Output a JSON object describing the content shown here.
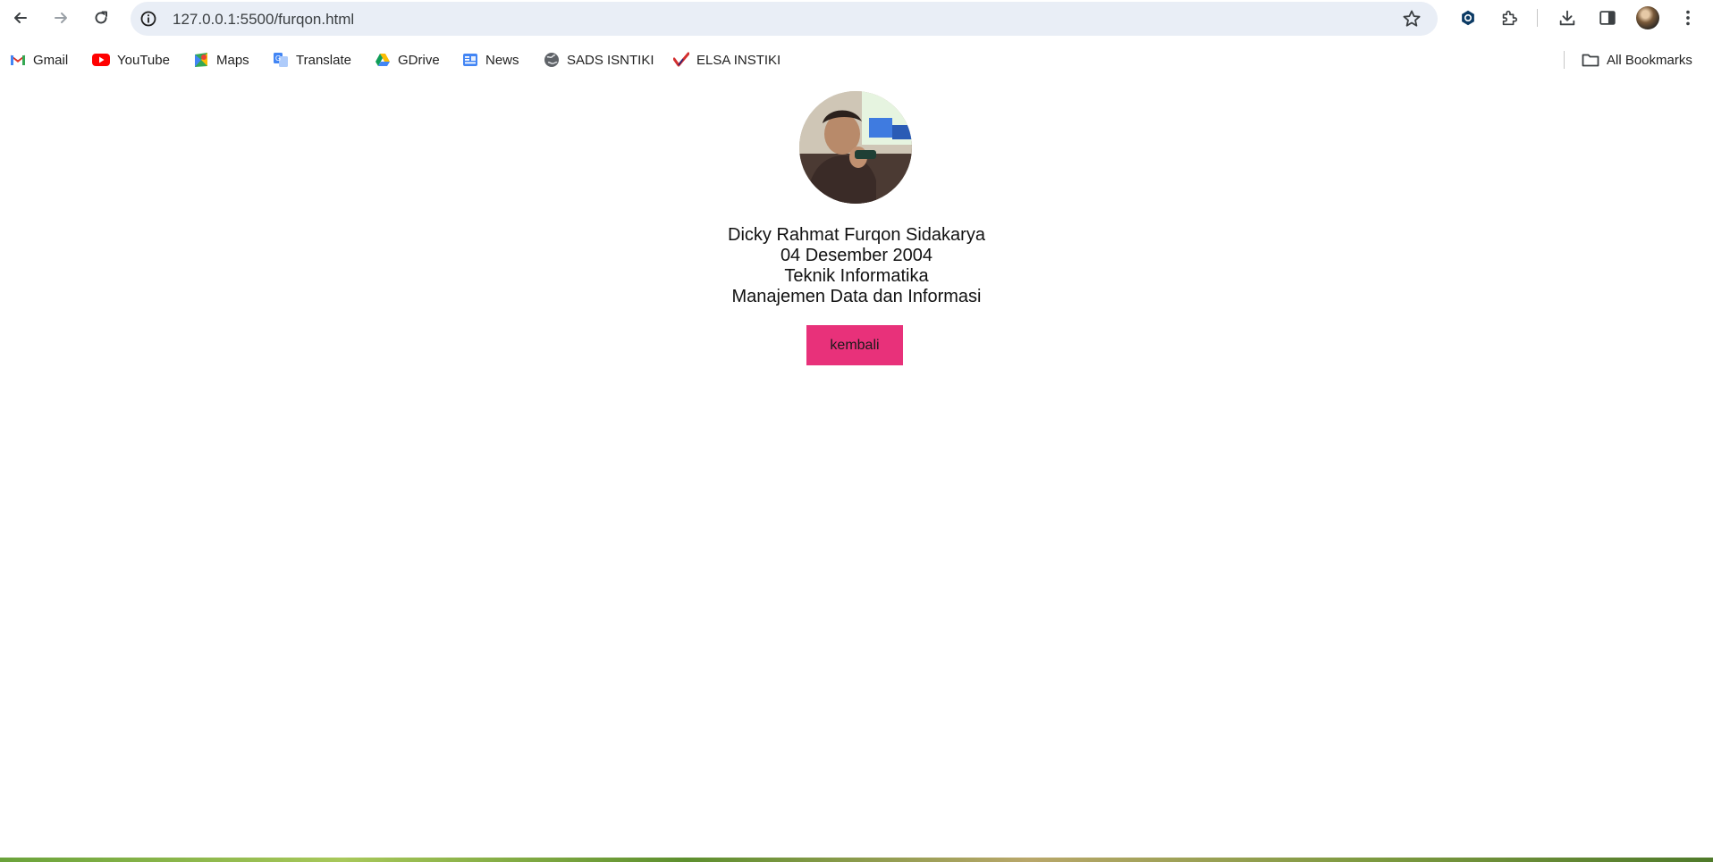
{
  "browser": {
    "url": "127.0.0.1:5500/furqon.html",
    "bookmarks": [
      {
        "label": "Gmail",
        "icon": "gmail-icon"
      },
      {
        "label": "YouTube",
        "icon": "youtube-icon"
      },
      {
        "label": "Maps",
        "icon": "maps-icon"
      },
      {
        "label": "Translate",
        "icon": "translate-icon"
      },
      {
        "label": "GDrive",
        "icon": "gdrive-icon"
      },
      {
        "label": "News",
        "icon": "news-icon"
      },
      {
        "label": "SADS ISNTIKI",
        "icon": "globe-icon"
      },
      {
        "label": "ELSA INSTIKI",
        "icon": "elsa-icon"
      }
    ],
    "all_bookmarks_label": "All Bookmarks"
  },
  "profile": {
    "name": "Dicky Rahmat Furqon Sidakarya",
    "birth_date": "04 Desember 2004",
    "major": "Teknik Informatika",
    "concentration": "Manajemen Data dan Informasi",
    "back_button_label": "kembali"
  },
  "colors": {
    "button_bg": "#e8317a",
    "omnibox_bg": "#e9eef6"
  }
}
